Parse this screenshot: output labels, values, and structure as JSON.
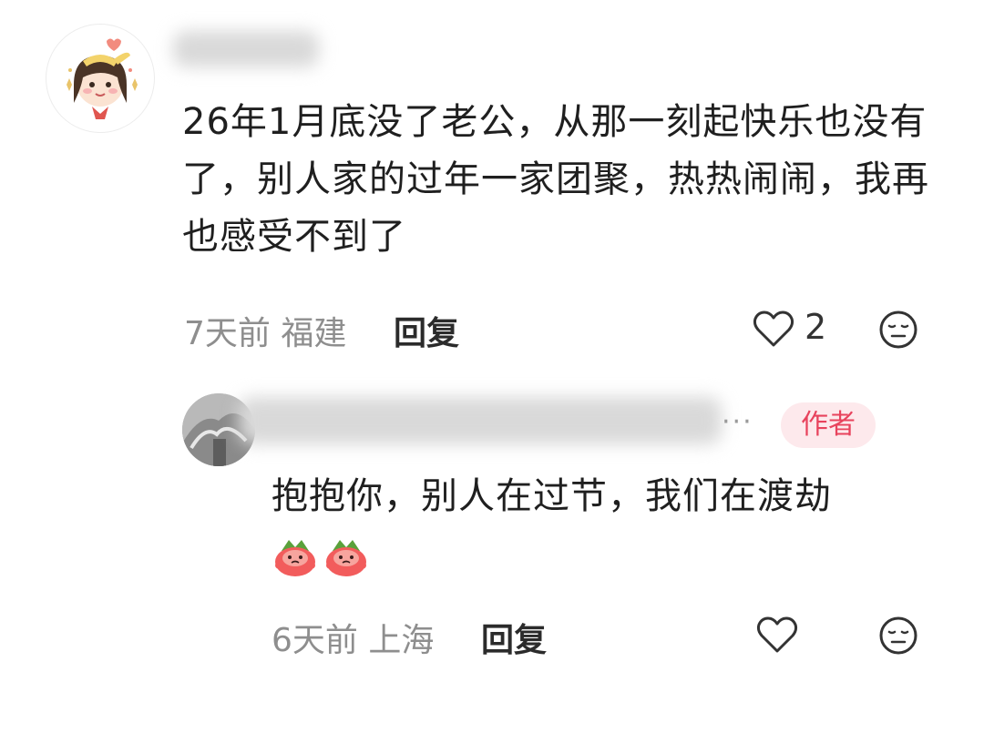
{
  "comments": [
    {
      "text": "26年1月底没了老公，从那一刻起快乐也没有了，别人家的过年一家团聚，热热闹闹，我再也感受不到了",
      "time": "7天前",
      "location": "福建",
      "reply_label": "回复",
      "like_count": "2",
      "icons": [
        "heart-outline-icon",
        "neutral-face-icon"
      ]
    },
    {
      "author_badge": "作者",
      "more_label": "···",
      "text": "抱抱你，别人在过节，我们在渡劫",
      "stickers": [
        "sad-peach-sticker",
        "sad-peach-sticker"
      ],
      "time": "6天前",
      "location": "上海",
      "reply_label": "回复",
      "icons": [
        "heart-outline-icon",
        "neutral-face-icon"
      ]
    }
  ],
  "colors": {
    "text": "#1f1f1f",
    "meta": "#8e8e8e",
    "author_badge_bg": "#fde9ec",
    "author_badge_text": "#e8435d"
  }
}
